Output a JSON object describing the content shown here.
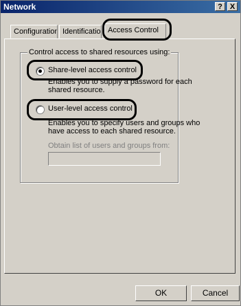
{
  "window": {
    "title": "Network",
    "help_button": "?",
    "close_button": "X"
  },
  "tabs": [
    {
      "label": "Configuration",
      "active": false
    },
    {
      "label": "Identification",
      "active": false
    },
    {
      "label": "Access Control",
      "active": true
    }
  ],
  "access_group": {
    "legend": "Control access to shared resources using:",
    "options": [
      {
        "label": "Share-level access control",
        "selected": true,
        "description": "Enables you to supply a password for each shared resource."
      },
      {
        "label": "User-level access control",
        "selected": false,
        "description": "Enables you to specify users and groups who have access to each shared resource."
      }
    ],
    "obtain_label": "Obtain list of users and groups from:",
    "obtain_value": ""
  },
  "buttons": {
    "ok": "OK",
    "cancel": "Cancel"
  },
  "callout_color": "#000000"
}
